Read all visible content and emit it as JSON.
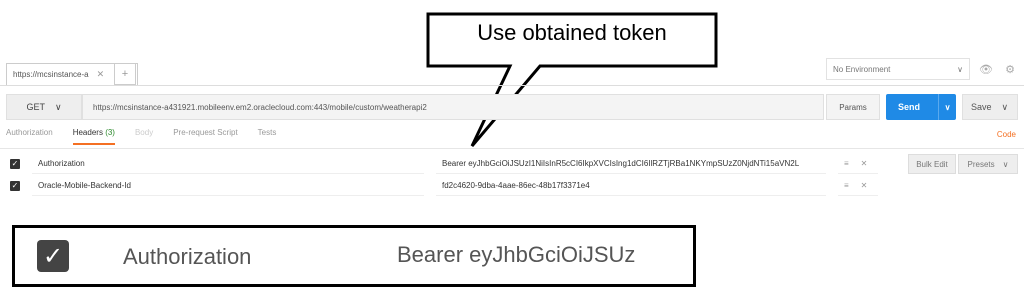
{
  "callout": {
    "text": "Use obtained token"
  },
  "tabs": [
    {
      "label": "https://mcsinstance-a"
    }
  ],
  "tab_close": "✕",
  "tab_add": "+",
  "environment": {
    "selected": "No Environment",
    "chevron": "∨"
  },
  "top_icons": {
    "eye": "👁",
    "gear": "⚙"
  },
  "request": {
    "method": "GET",
    "method_chevron": "∨",
    "url": "https://mcsinstance-a431921.mobileenv.em2.oraclecloud.com:443/mobile/custom/weatherapi2",
    "params_label": "Params",
    "send_label": "Send",
    "send_chevron": "∨",
    "save_label": "Save",
    "save_chevron": "∨"
  },
  "subtabs": {
    "authorization": "Authorization",
    "headers": "Headers",
    "headers_count": "(3)",
    "body": "Body",
    "prerequest": "Pre-request Script",
    "tests": "Tests",
    "code": "Code"
  },
  "headers_rows": [
    {
      "checked": true,
      "check_glyph": "✓",
      "key": "Authorization",
      "value": "Bearer eyJhbGciOiJSUzI1NiIsInR5cCI6IkpXVCIsIng1dCI6IlRZTjRBa1NKYmpSUzZ0NjdNTi15aVN2L",
      "menu": "≡",
      "remove": "✕"
    },
    {
      "checked": true,
      "check_glyph": "✓",
      "key": "Oracle-Mobile-Backend-Id",
      "value": "fd2c4620-9dba-4aae-86ec-48b17f3371e4",
      "menu": "≡",
      "remove": "✕"
    }
  ],
  "bulk_edit_label": "Bulk Edit",
  "presets_label": "Presets",
  "presets_chevron": "∨",
  "zoom": {
    "check_glyph": "✓",
    "key": "Authorization",
    "value": "Bearer eyJhbGciOiJSUz"
  }
}
